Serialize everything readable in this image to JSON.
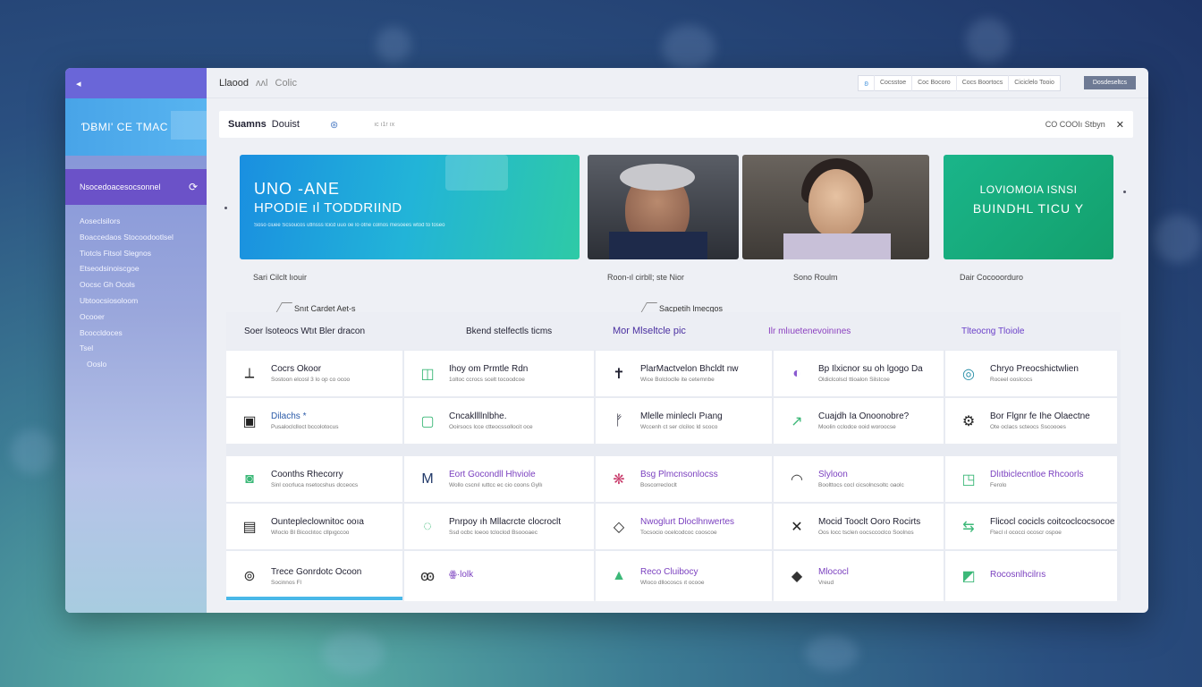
{
  "topbar": {
    "title": "Llaood",
    "title2": "ʌʌl",
    "subtitle": "Colic",
    "pills": [
      "ʚ",
      "Cocsstoe",
      "Coc Bocoro",
      "Cocs Boortocs",
      "Ciciclelo Tooio"
    ],
    "button": "Dosdeseltcs"
  },
  "sidebar": {
    "back_icon": "◂",
    "brand": "ƊɃMI' CE TMAC",
    "active_item": "Nsocedoacesocsonnel",
    "active_icon": "⟳",
    "items": [
      "Aoseclsilors",
      "Boaccedaos Stocoodootlsel",
      "Tiotcls Fitsol Slegnos",
      "Etseodsinoiscgoe",
      "Oocsc Gh Ocols",
      "Ubtoocsiosoloom",
      "Ocooer",
      "Bcoccldoces",
      "Tsel",
      "Ooslo"
    ]
  },
  "search": {
    "label": "Suamns",
    "label2": "Douist",
    "icon": "search-icon",
    "small": "ıc ı1r ıx",
    "right_text": "CO COOIı Stbyn",
    "close": "✕"
  },
  "banners": [
    {
      "line1": "UNO -ANE",
      "line2": "HPODIE ıl TODDRIIND",
      "line3": "Soso ciuee Scsoucos utlnsss lcicd uuo oe lo otne colnos mesoees wtod to toseo"
    },
    {
      "line1": "LOVIOMOIA ISNSI",
      "line2": "BUINDHL TICU Y"
    }
  ],
  "captions": [
    "Sari Cilclt lıouir",
    "Roon-ıl cirbll; ste Nior",
    "Sono Roulm",
    "Dair Cocooorduro"
  ],
  "sub_captions": [
    "Snıt Cardet Aet-s",
    "Sacpetih lmecgos"
  ],
  "section_headers": [
    "Soer lsoteocs Wtıt Bler dracon",
    "Bkend stelfectls ticms",
    "Mor Mlseltcle pic",
    "Ilr mlıuetenevoinınes",
    "Tlteocng Tloiole"
  ],
  "rows": [
    [
      {
        "icon": "⟂",
        "title": "Cocrs Okoor",
        "sub": "Sostoon elcosl 3 lo op co ocoo"
      },
      {
        "icon": "◫",
        "title": "Ihoy om Prmtle Rdn",
        "sub": "1oltoc ccrocs scelt tocoodcoe"
      },
      {
        "icon": "✝",
        "title": "PlarMactvelon Bhcldt nw",
        "sub": "Wice Bolcloclle ite cetemnbe"
      },
      {
        "icon": "◐",
        "title": "Bp Ilxicnor su oh lgogo Da",
        "sub": "Oldiclcolscl ttioalon Silstcoe"
      },
      {
        "icon": "◎",
        "title": "Chryo Preocshictwlien",
        "sub": "Roceel ooslcocs"
      }
    ],
    [
      {
        "icon": "▣",
        "title": "Dilachs *",
        "sub": "Pusaloclclloct bccolotocus"
      },
      {
        "icon": "▢",
        "title": "Cncakllllnlbhe.",
        "sub": "Ooirsocs lcce ctteocssollocit oce"
      },
      {
        "icon": "ᚠ",
        "title": "Mlelle minleclı Pıang",
        "sub": "Wccenh ct ser clciloc ld scoco"
      },
      {
        "icon": "↗",
        "title": "Cuajdh Ia Onoonobre?",
        "sub": "Moolin cclodce ooid woroocse"
      },
      {
        "icon": "⚙",
        "title": "Bor Flgnr fe Ihe Olaectne",
        "sub": "Ote oclacs scteocs Sscoooes"
      }
    ],
    [
      {
        "icon": "◙",
        "title": "Coonths Rhecorry",
        "sub": "Sinl cocrluca nsetocshus dcceocs"
      },
      {
        "icon": "M",
        "title": "Eort Gocondll Hhviole",
        "sub": "Wollo cscnıl ıuttcc ec cio coons Gyllı"
      },
      {
        "icon": "❋",
        "title": "Bsg Plmcnsonlocss",
        "sub": "Boscorrecloclt"
      },
      {
        "icon": "◠",
        "title": "Slyloon",
        "sub": "Boolttocs cocl cicsolncsoltc oaolc"
      },
      {
        "icon": "◳",
        "title": "Dlıtbiclecntloe Rhcoorls",
        "sub": "Ferolo"
      }
    ],
    [
      {
        "icon": "▤",
        "title": "Ountepleclownitoc ooıa",
        "sub": "Wloclo Bl Bicoclıtoc cllpıgccoo"
      },
      {
        "icon": "◌",
        "title": "Pnrpoy ıh Mllacrcte clocroclt",
        "sub": "Ssd ocbc loeoo tcloclod Bsoooaec"
      },
      {
        "icon": "◇",
        "title": "Nwoglurt Dloclhnwertes",
        "sub": "Tocsocio ocelcodcoc cooscoe"
      },
      {
        "icon": "✕",
        "title": "Mocid Tooclt Ooro Rocirts",
        "sub": "Oos locc tsclen oocsccoclco Soolnos"
      },
      {
        "icon": "⇆",
        "title": "Flicocl cocicls coitcoclcocsocoe",
        "sub": "Ftecl ıl ococci ocoscr ospoe"
      }
    ],
    [
      {
        "icon": "⊚",
        "title": "Trece Gonrdotc Ocoon",
        "sub": "Socinnos Fl"
      },
      {
        "icon": "ꙭ",
        "title": "ꙮ·lolk",
        "sub": ""
      },
      {
        "icon": "▲",
        "title": "Reco Cluibocy",
        "sub": "Wloco dllocoscs ıt ocooe"
      },
      {
        "icon": "◆",
        "title": "Mlococl",
        "sub": "Vreud"
      },
      {
        "icon": "◩",
        "title": "Rocosnlhcilrıs",
        "sub": ""
      }
    ]
  ],
  "progress_fraction": 1.0,
  "colors": {
    "accent_purple": "#6b52c8",
    "accent_blue": "#1a8fe0",
    "accent_green": "#1ab58a",
    "icon_green": "#3cb878",
    "icon_purple": "#8a5ad0",
    "text_purple": "#7a3fbf"
  }
}
